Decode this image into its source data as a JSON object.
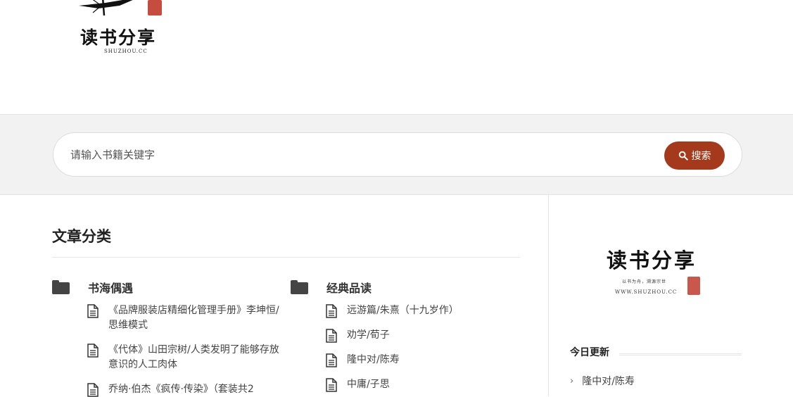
{
  "header": {
    "logo_title": "读书分享",
    "logo_subtitle": "SHUZHOU.CC"
  },
  "search": {
    "placeholder": "请输入书籍关键字",
    "button_label": "搜索"
  },
  "main": {
    "section_title": "文章分类",
    "categories": [
      {
        "name": "书海偶遇",
        "items": [
          "《品牌服装店精细化管理手册》李坤恒/思维模式",
          "《代体》山田宗树/人类发明了能够存放意识的人工肉体",
          "乔纳·伯杰《疯传·传染》（套装共2"
        ]
      },
      {
        "name": "经典品读",
        "items": [
          "远游篇/朱熹（十九岁作）",
          "劝学/荀子",
          "隆中对/陈寿",
          "中庸/子思"
        ]
      }
    ]
  },
  "sidebar": {
    "logo_title": "读书分享",
    "logo_tagline": "以书为舟，溯源宗世",
    "logo_url": "WWW.SHUZHOU.CC",
    "today_title": "今日更新",
    "recent_items": [
      "隆中对/陈寿"
    ]
  },
  "colors": {
    "accent": "#a5391b",
    "band": "#f2f2f2"
  }
}
